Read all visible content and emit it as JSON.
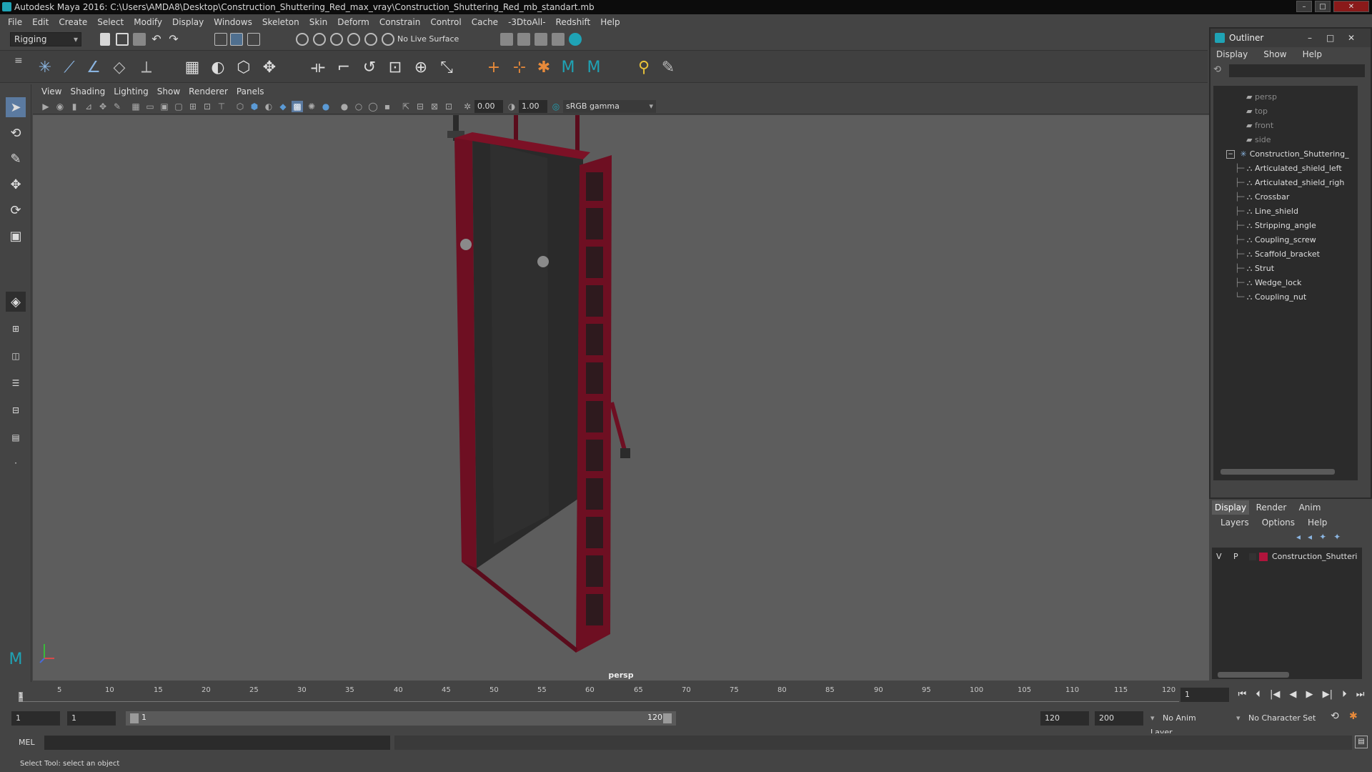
{
  "window": {
    "title": "Autodesk Maya 2016: C:\\Users\\AMDA8\\Desktop\\Construction_Shuttering_Red_max_vray\\Construction_Shuttering_Red_mb_standart.mb",
    "min": "–",
    "max": "□",
    "close": "✕"
  },
  "menubar": [
    "File",
    "Edit",
    "Create",
    "Select",
    "Modify",
    "Display",
    "Windows",
    "Skeleton",
    "Skin",
    "Deform",
    "Constrain",
    "Control",
    "Cache",
    "-3DtoAll-",
    "Redshift",
    "Help"
  ],
  "statusline": {
    "menu_set": "Rigging",
    "live_surface": "No Live Surface"
  },
  "panel_menu": [
    "View",
    "Shading",
    "Lighting",
    "Show",
    "Renderer",
    "Panels"
  ],
  "panel_toolbar": {
    "exposure": "0.00",
    "gamma": "1.00",
    "color_space": "sRGB gamma"
  },
  "viewport": {
    "camera": "persp"
  },
  "timeline": {
    "ticks": [
      "5",
      "10",
      "15",
      "20",
      "25",
      "30",
      "35",
      "40",
      "45",
      "50",
      "55",
      "60",
      "65",
      "70",
      "75",
      "80",
      "85",
      "90",
      "95",
      "100",
      "105",
      "110",
      "115",
      "120"
    ],
    "start_label": "1",
    "current_frame": "1"
  },
  "range": {
    "start": "1",
    "playback_start": "1",
    "slider_start": "1",
    "slider_end": "120",
    "playback_end": "120",
    "end": "200",
    "anim_layer": "No Anim Layer",
    "character_set": "No Character Set"
  },
  "command": {
    "lang": "MEL"
  },
  "help_line": "Select Tool: select an object",
  "outliner": {
    "title": "Outliner",
    "menu": [
      "Display",
      "Show",
      "Help"
    ],
    "cameras": [
      "persp",
      "top",
      "front",
      "side"
    ],
    "group": "Construction_Shuttering_",
    "children": [
      "Articulated_shield_left",
      "Articulated_shield_righ",
      "Crossbar",
      "Line_shield",
      "Stripping_angle",
      "Coupling_screw",
      "Scaffold_bracket",
      "Strut",
      "Wedge_lock",
      "Coupling_nut"
    ]
  },
  "layer_editor": {
    "tabs": [
      "Display",
      "Render",
      "Anim"
    ],
    "menu": [
      "Layers",
      "Options",
      "Help"
    ],
    "layer": {
      "v": "V",
      "p": "P",
      "name": "Construction_Shutteri",
      "color": "#b0143c"
    }
  },
  "colors": {
    "frame_red": "#6e0f22",
    "panel_dark": "#2a2a2a",
    "viewport_bg": "#5d5d5d"
  }
}
